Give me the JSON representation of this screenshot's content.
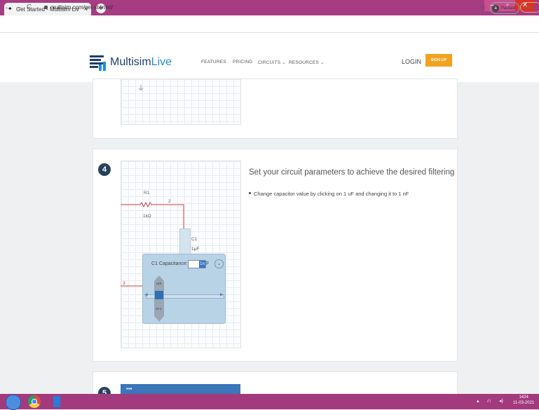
{
  "browser": {
    "tab_title": "Get Started - Multisim Liv",
    "tab_close": "×",
    "new_tab": "+",
    "url": "multisim.com/get-started/",
    "profile_initial": "a",
    "paused_label": "Paused",
    "error_label": "Error"
  },
  "site": {
    "logo_main": "Multisim",
    "logo_accent": "Live",
    "nav": [
      "FEATURES",
      "PRICING",
      "CIRCUITS",
      "RESOURCES"
    ],
    "login": "LOGIN",
    "signup": "SIGN UP"
  },
  "step4": {
    "number": "4",
    "title": "Set your circuit parameters to achieve the desired filtering",
    "bullet": "Change capacitor value by clicking on 1 uF and changing it to 1 nF",
    "circuit": {
      "r1_label": "R1",
      "r1_value": "1kΩ",
      "node2": "2",
      "node3": "3",
      "c1_label": "C1",
      "c1_value": "1μF",
      "popup_label": "C1 Capacitance:",
      "popup_selected": "1n",
      "popup_unit": "F",
      "knob_top": "x10",
      "knob_bottom": "x0.1"
    }
  },
  "step5": {
    "number": "5",
    "bar_text": "▪▪▪"
  },
  "taskbar": {
    "time": "1424",
    "date": "11-03-2021"
  }
}
